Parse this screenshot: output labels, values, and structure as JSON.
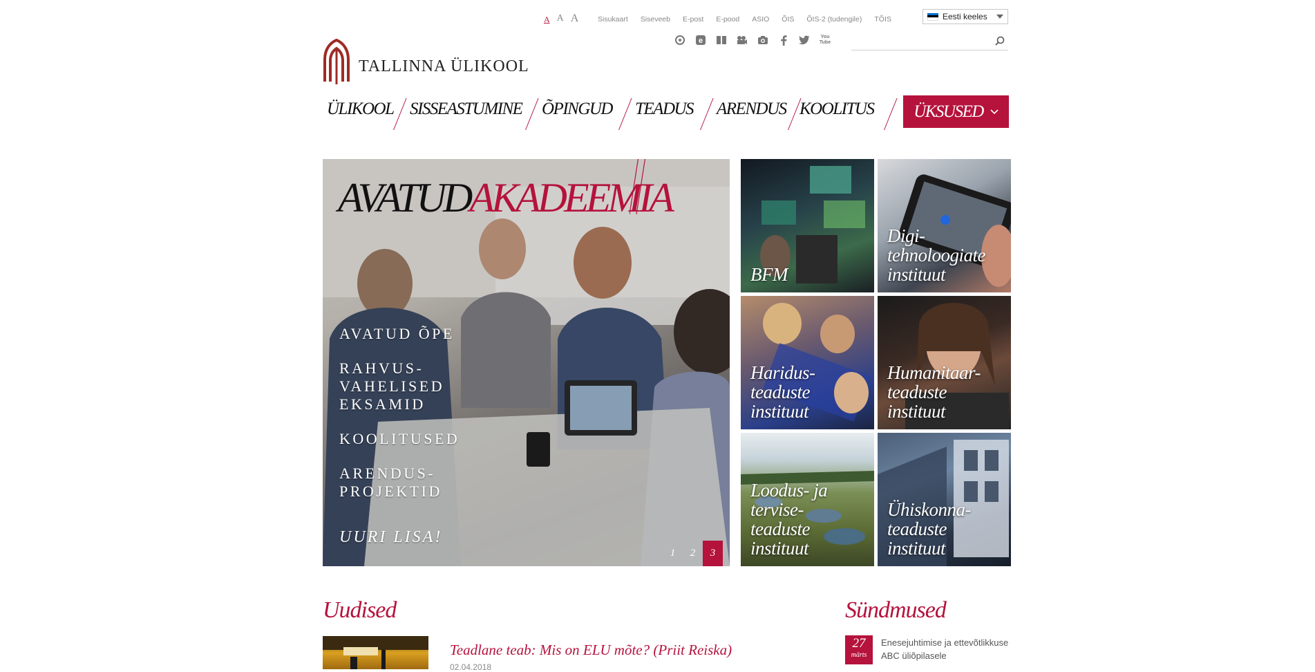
{
  "colors": {
    "brand": "#b5123c",
    "text": "#111111",
    "muted": "#888888"
  },
  "font_sizes": [
    "A",
    "A",
    "A"
  ],
  "top_links": [
    "Sisukaart",
    "Siseveeb",
    "E-post",
    "E-pood",
    "ASIO",
    "ÕIS",
    "ÕIS-2 (tudengile)",
    "TÕIS"
  ],
  "language": {
    "selected": "Eesti keeles"
  },
  "social_icons": [
    "cycle-icon",
    "e-icon",
    "book-icon",
    "video-camera-icon",
    "camera-icon",
    "facebook-icon",
    "twitter-icon",
    "youtube-icon"
  ],
  "youtube_label": "You Tube",
  "search": {
    "placeholder": ""
  },
  "logo": {
    "text": "TALLINNA ÜLIKOOL"
  },
  "nav": {
    "items": [
      "ÜLIKOOL",
      "SISSEASTUMINE",
      "ÕPINGUD",
      "TEADUS",
      "ARENDUS",
      "KOOLITUS"
    ],
    "dropdown": "ÜKSUSED"
  },
  "hero": {
    "title_part1": "AVATUD",
    "title_part2": "AKADEEMIA",
    "menu": [
      "AVATUD ÕPE",
      "RAHVUS-\nVAHELISED\nEKSAMID",
      "KOOLITUSED",
      "ARENDUS-\nPROJEKTID"
    ],
    "more": "UURI LISA!",
    "slides": [
      "1",
      "2",
      "3"
    ],
    "active_slide": 3
  },
  "tiles": [
    {
      "label": "BFM"
    },
    {
      "label": "Digi-\ntehnoloogiate\ninstituut"
    },
    {
      "label": "Haridus-\nteaduste\ninstituut"
    },
    {
      "label": "Humanitaar-\nteaduste\ninstituut"
    },
    {
      "label": "Loodus- ja\ntervise-\nteaduste\ninstituut"
    },
    {
      "label": "Ühiskonna-\nteaduste\ninstituut"
    }
  ],
  "news": {
    "heading": "Uudised",
    "items": [
      {
        "title": "Teadlane teab: Mis on ELU mõte? (Priit Reiska)",
        "date": "02.04.2018"
      }
    ]
  },
  "events": {
    "heading": "Sündmused",
    "items": [
      {
        "day": "27",
        "month": "märts",
        "title": "Enesejuhtimise ja ettevõtlikkuse ABC üliõpilasele"
      }
    ]
  }
}
